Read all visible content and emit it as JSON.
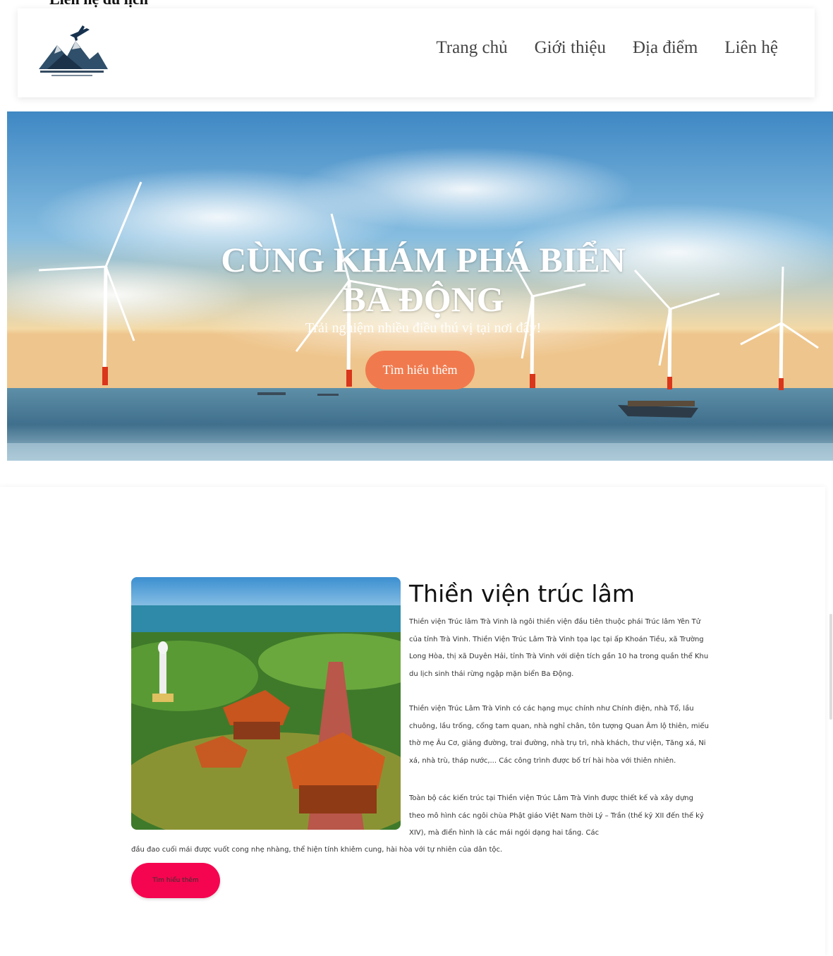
{
  "page": {
    "top_clipped_text": "Liên hệ du lịch",
    "accent_color": "#f07a4e",
    "cta_color": "#f5054f"
  },
  "header": {
    "logo_icon": "airplane-mountain-logo-icon",
    "nav": [
      {
        "label": "Trang chủ"
      },
      {
        "label": "Giới thiệu"
      },
      {
        "label": "Địa điểm"
      },
      {
        "label": "Liên hệ"
      }
    ]
  },
  "hero": {
    "title": "CÙNG KHÁM PHÁ BIỂN BA ĐỘNG",
    "subtitle": "Trải nghiệm nhiều điều thú vị tại nơi đây!",
    "button_label": "Tìm hiểu thêm"
  },
  "feature": {
    "title": "Thiền viện trúc lâm",
    "paragraph1": "Thiền viện Trúc lâm Trà Vinh là ngôi thiền viện đầu tiên thuộc phái Trúc lâm Yên Tử của tỉnh Trà Vinh. Thiền Viện Trúc Lâm Trà Vinh tọa lạc tại ấp Khoán Tiều, xã Trường Long Hòa, thị xã Duyên Hải, tỉnh Trà Vinh với diện tích gần 10 ha trong quần thể Khu du lịch sinh thái rừng ngập mặn biển Ba Động.",
    "paragraph2": "Thiền viện Trúc Lâm Trà Vinh có các hạng mục chính như Chính điện, nhà Tổ, lầu chuông, lầu trống, cổng tam quan, nhà nghỉ chân, tôn tượng Quan Âm lộ thiên, miếu thờ mẹ Âu Cơ, giảng đường, trai đường, nhà trụ trì, nhà khách, thư viện, Tăng xá, Ni xá, nhà trù, tháp nước,... Các công trình được bố trí hài hòa với thiên nhiên.",
    "paragraph3a": "Toàn bộ các kiến trúc tại Thiền viện Trúc Lâm Trà Vinh được thiết kế và xây dựng theo mô hình các ngôi chùa Phật giáo Việt Nam thời Lý – Trần (thế kỷ XII đến thế kỷ XIV), mà điển hình là các mái ngói dạng hai tầng. Các",
    "paragraph3b": "đầu đao cuối mái được vuốt cong nhẹ nhàng, thể hiện tính khiêm cung, hài hòa với tự nhiên của dân tộc.",
    "button_label": "Tìm hiểu thêm"
  }
}
